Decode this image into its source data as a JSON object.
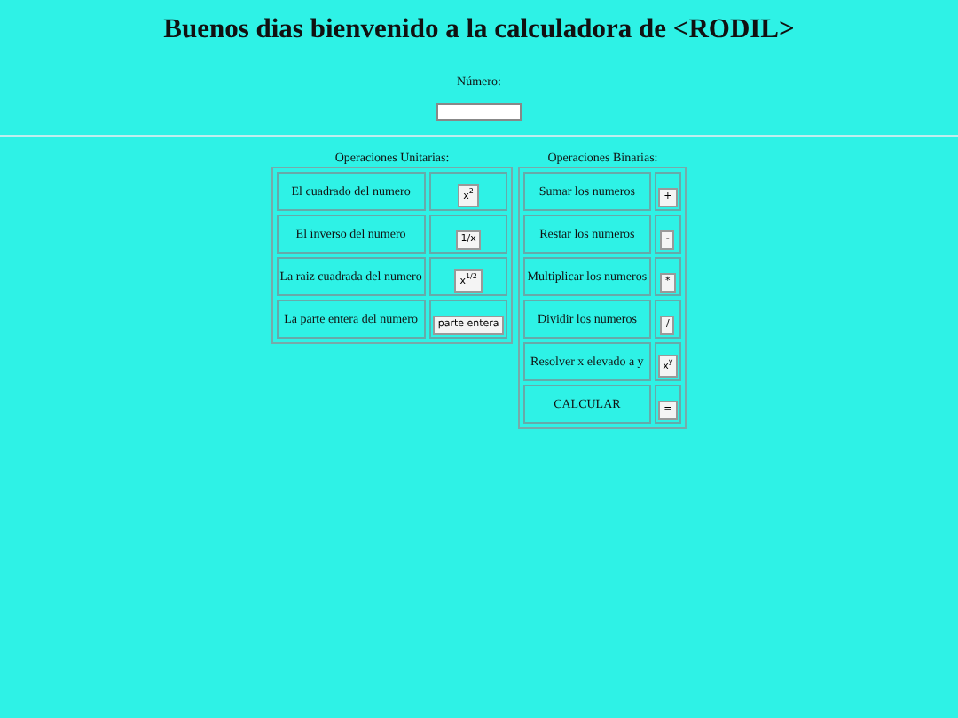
{
  "title": "Buenos dias bienvenido a la calculadora de <RODIL>",
  "number_field": {
    "label": "Número:"
  },
  "panels": [
    {
      "heading": "Operaciones Unitarias:",
      "rows": [
        {
          "label": "El cuadrado del numero",
          "button": "x$^{2}$"
        },
        {
          "label": "El inverso del numero",
          "button": "1/x"
        },
        {
          "label": "La raiz cuadrada del numero",
          "button": "x$^{1/2}$"
        },
        {
          "label": "La parte entera del numero",
          "button": "parte entera"
        }
      ]
    },
    {
      "heading": "Operaciones Binarias:",
      "rows": [
        {
          "label": "Sumar los numeros",
          "button": "+"
        },
        {
          "label": "Restar los numeros",
          "button": "-"
        },
        {
          "label": "Multiplicar los numeros",
          "button": "*"
        },
        {
          "label": "Dividir los numeros",
          "button": "/"
        },
        {
          "label": "Resolver x elevado a y",
          "button": "x$^{y}$"
        },
        {
          "label": "CALCULAR",
          "button": "="
        }
      ]
    }
  ]
}
